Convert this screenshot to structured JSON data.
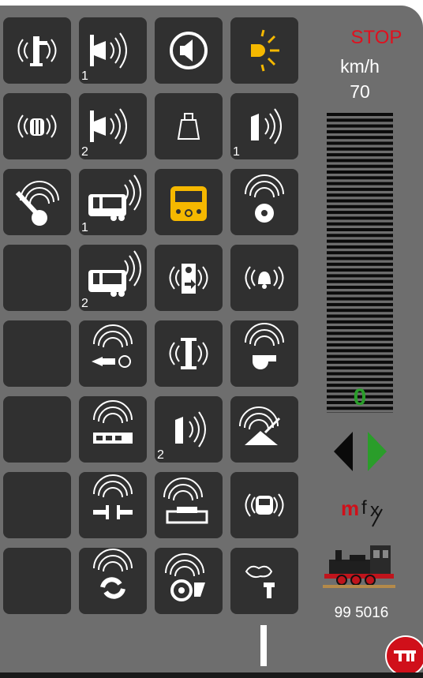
{
  "speed": {
    "stop_label": "STOP",
    "unit": "km/h",
    "value": "70",
    "current": "0",
    "level": 0
  },
  "loco": {
    "id": "99 5016",
    "protocol_logo": "mfx",
    "image": "steam-locomotive"
  },
  "colors": {
    "panel": "#6e6e6e",
    "button": "#303030",
    "active_icon": "#f5b800",
    "stop": "#e0101e",
    "forward": "#2a9d2a"
  },
  "functions": [
    {
      "icon": "water-crane-sound-icon",
      "num": ""
    },
    {
      "icon": "horn-sound-icon",
      "num": "1"
    },
    {
      "icon": "sound-mute-icon",
      "num": ""
    },
    {
      "icon": "headlight-icon",
      "num": "",
      "active": true
    },
    {
      "icon": "coal-shovel-sound-icon",
      "num": ""
    },
    {
      "icon": "horn-sound-icon",
      "num": "2"
    },
    {
      "icon": "weight-icon",
      "num": ""
    },
    {
      "icon": "door-sound-icon",
      "num": "1"
    },
    {
      "icon": "coal-sound-icon",
      "num": ""
    },
    {
      "icon": "cab-sound-icon",
      "num": "1"
    },
    {
      "icon": "cab-light-icon",
      "num": "",
      "active": true
    },
    {
      "icon": "wheel-squeal-sound-icon",
      "num": ""
    },
    {
      "icon": "empty-slot",
      "num": ""
    },
    {
      "icon": "cab-sound-icon",
      "num": "2"
    },
    {
      "icon": "door-close-sound-icon",
      "num": ""
    },
    {
      "icon": "bell-sound-icon",
      "num": ""
    },
    {
      "icon": "empty-slot",
      "num": ""
    },
    {
      "icon": "air-pump-sound-icon",
      "num": ""
    },
    {
      "icon": "compressor-sound-icon",
      "num": ""
    },
    {
      "icon": "whistle-sound-icon",
      "num": ""
    },
    {
      "icon": "empty-slot",
      "num": ""
    },
    {
      "icon": "grate-shaking-sound-icon",
      "num": ""
    },
    {
      "icon": "door-sound-icon",
      "num": "2"
    },
    {
      "icon": "shoveling-sound-icon",
      "num": ""
    },
    {
      "icon": "empty-slot",
      "num": ""
    },
    {
      "icon": "coupling-sound-icon",
      "num": ""
    },
    {
      "icon": "water-fill-sound-icon",
      "num": ""
    },
    {
      "icon": "conductor-sound-icon",
      "num": ""
    },
    {
      "icon": "empty-slot",
      "num": ""
    },
    {
      "icon": "shunting-sound-icon",
      "num": ""
    },
    {
      "icon": "brake-sound-icon",
      "num": ""
    },
    {
      "icon": "steam-sound-icon",
      "num": ""
    }
  ]
}
